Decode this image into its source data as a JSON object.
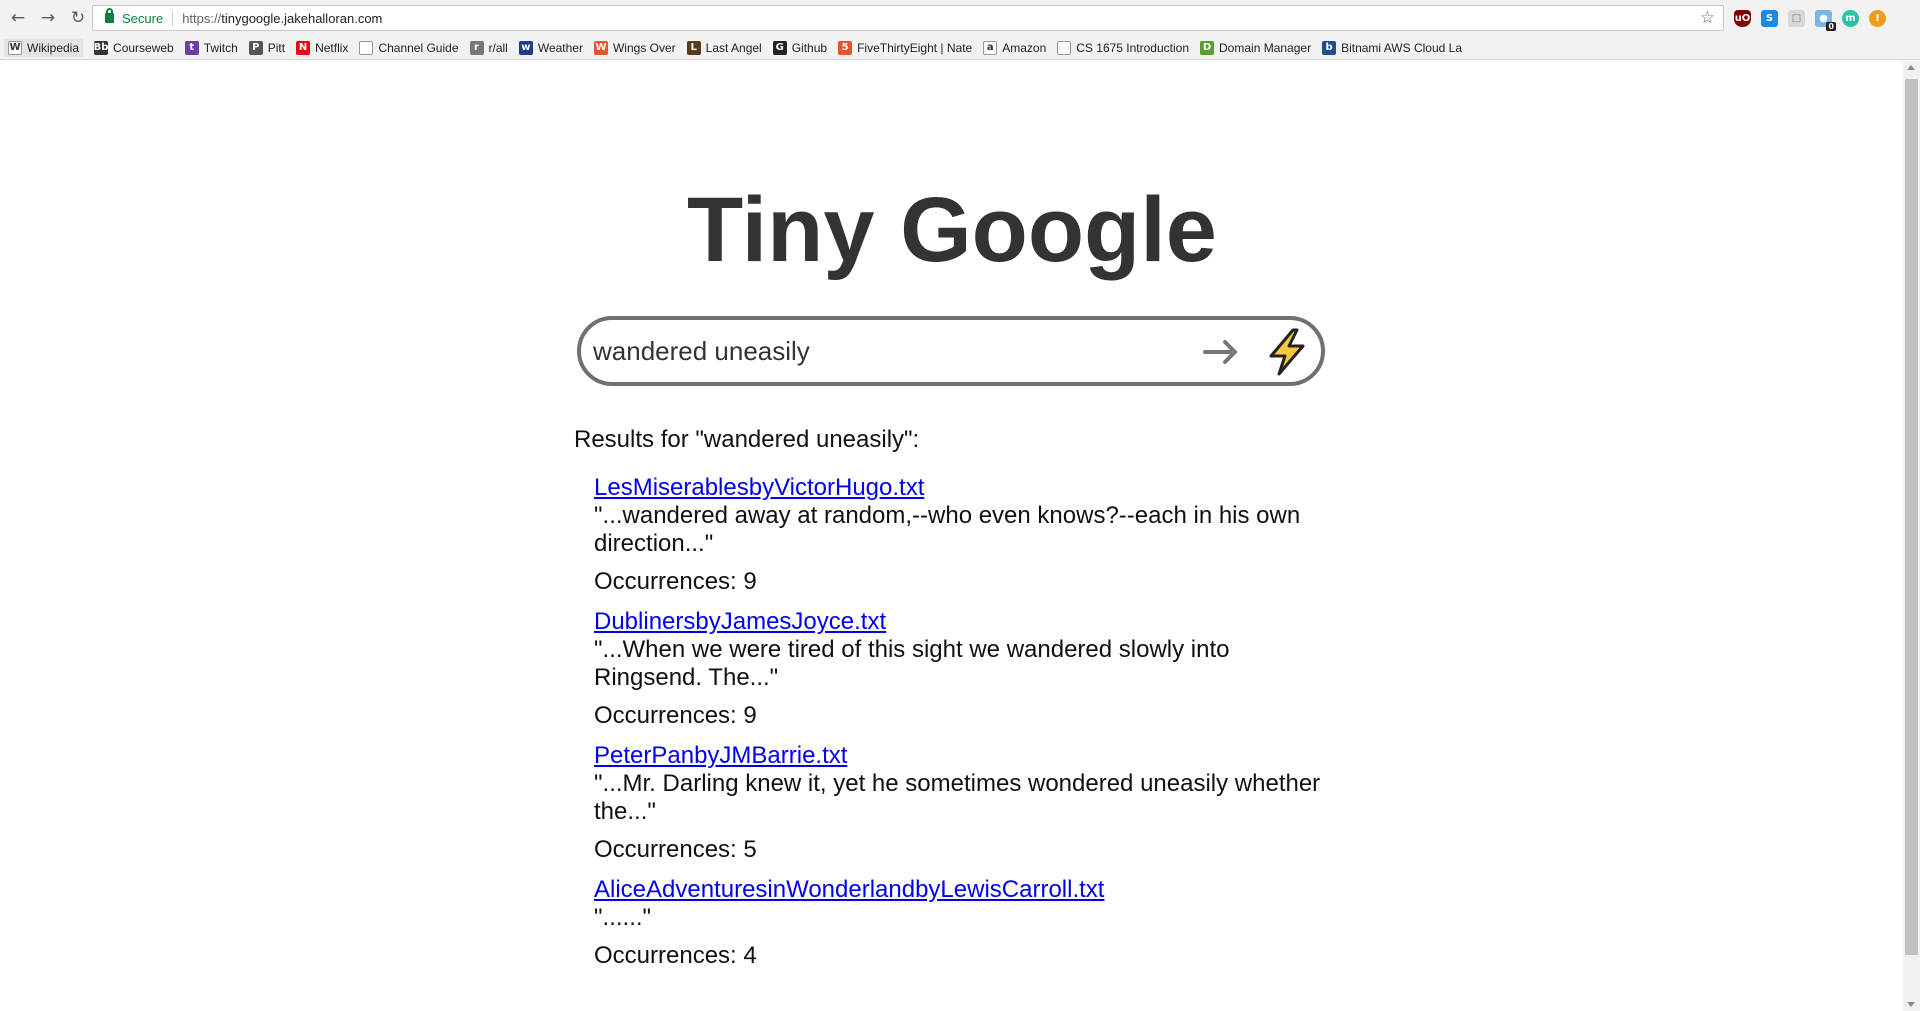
{
  "browser": {
    "secure_label": "Secure",
    "url_scheme": "https://",
    "url_host": "tinygoogle.jakehalloran.com",
    "bookmarks": [
      {
        "label": "Wikipedia",
        "icon": "wikipedia-icon",
        "glyph": "W",
        "color": "#ffffff"
      },
      {
        "label": "Courseweb",
        "icon": "courseweb-icon",
        "glyph": "Bb",
        "color": "#333333"
      },
      {
        "label": "Twitch",
        "icon": "twitch-icon",
        "glyph": "t",
        "color": "#6441a5"
      },
      {
        "label": "Pitt",
        "icon": "pitt-icon",
        "glyph": "P",
        "color": "#555555"
      },
      {
        "label": "Netflix",
        "icon": "netflix-icon",
        "glyph": "N",
        "color": "#e50914"
      },
      {
        "label": "Channel Guide",
        "icon": "page-icon",
        "glyph": "",
        "color": "#ffffff"
      },
      {
        "label": "r/all",
        "icon": "reddit-icon",
        "glyph": "r",
        "color": "#777777"
      },
      {
        "label": "Weather",
        "icon": "weather-icon",
        "glyph": "w",
        "color": "#1a3e8c"
      },
      {
        "label": "Wings Over",
        "icon": "wings-over-icon",
        "glyph": "W",
        "color": "#e8552a"
      },
      {
        "label": "Last Angel",
        "icon": "last-angel-icon",
        "glyph": "L",
        "color": "#5a3a1a"
      },
      {
        "label": "Github",
        "icon": "github-icon",
        "glyph": "G",
        "color": "#222222"
      },
      {
        "label": "FiveThirtyEight | Nate",
        "icon": "fivethirtyeight-icon",
        "glyph": "5",
        "color": "#e8552a"
      },
      {
        "label": "Amazon",
        "icon": "amazon-icon",
        "glyph": "a",
        "color": "#ffffff"
      },
      {
        "label": "CS 1675 Introduction",
        "icon": "page-icon",
        "glyph": "",
        "color": "#ffffff"
      },
      {
        "label": "Domain Manager",
        "icon": "domain-manager-icon",
        "glyph": "D",
        "color": "#5a9e2f"
      },
      {
        "label": "Bitnami AWS Cloud La",
        "icon": "bitnami-icon",
        "glyph": "b",
        "color": "#1e4f8c"
      }
    ],
    "extensions": {
      "ublock": "uO",
      "s": "S",
      "badge": "0",
      "m": "m",
      "orange": "!"
    }
  },
  "page": {
    "title": "Tiny Google",
    "search_value": "wandered uneasily",
    "results_heading": "Results for \"wandered uneasily\":",
    "results": [
      {
        "file": "LesMiserablesbyVictorHugo.txt",
        "snippet": "\"...wandered away at random,--who even knows?--each in his own direction...\"",
        "occurrences": "Occurrences: 9"
      },
      {
        "file": "DublinersbyJamesJoyce.txt",
        "snippet": "\"...When we were tired of this sight we wandered slowly into Ringsend. The...\"",
        "occurrences": "Occurrences: 9"
      },
      {
        "file": "PeterPanbyJMBarrie.txt",
        "snippet": "\"...Mr. Darling knew it, yet he sometimes wondered uneasily whether the...\"",
        "occurrences": "Occurrences: 5"
      },
      {
        "file": "AliceAdventuresinWonderlandbyLewisCarroll.txt",
        "snippet": "\"......\"",
        "occurrences": "Occurrences: 4"
      }
    ],
    "colors": {
      "title": "#333333",
      "link": "#0000ee",
      "search_border": "#707070",
      "bolt": "#f7c83a"
    }
  }
}
